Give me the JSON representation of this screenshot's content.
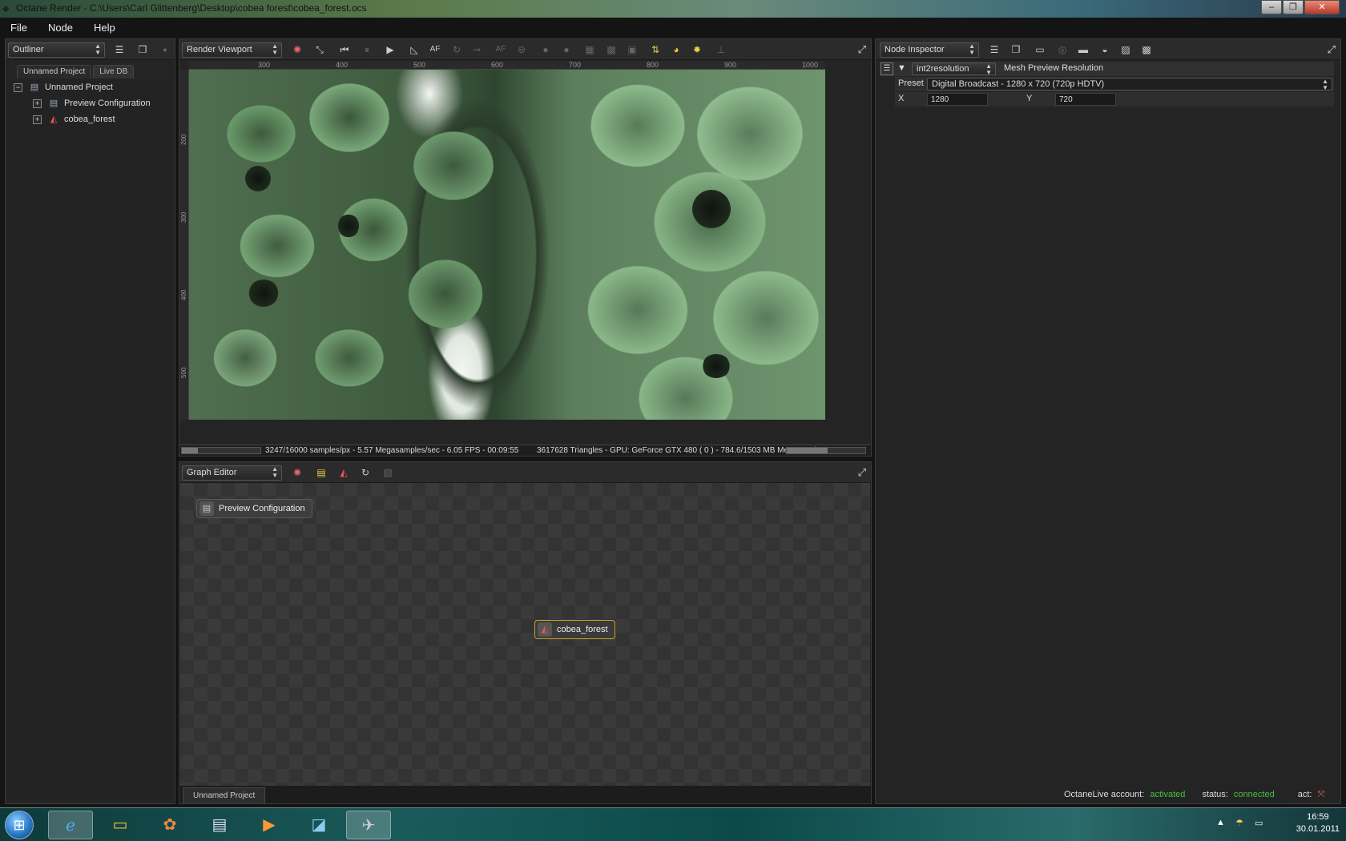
{
  "window": {
    "title": "Octane Render - C:\\Users\\Carl Glittenberg\\Desktop\\cobea forest\\cobea_forest.ocs",
    "minimize": "–",
    "maximize": "❐",
    "close": "✕"
  },
  "menu": {
    "items": [
      "File",
      "Node",
      "Help"
    ]
  },
  "outliner": {
    "dropdown": "Outliner",
    "tabs": [
      "Unnamed Project",
      "Live DB"
    ],
    "tree": [
      {
        "label": "Unnamed Project",
        "expander": "−",
        "icon": "project-icon"
      },
      {
        "label": "Preview Configuration",
        "expander": "+",
        "icon": "config-icon"
      },
      {
        "label": "cobea_forest",
        "expander": "+",
        "icon": "mesh-icon"
      }
    ]
  },
  "viewport": {
    "dropdown": "Render Viewport",
    "ruler_h": [
      "300",
      "400",
      "500",
      "600",
      "700",
      "800",
      "900",
      "1000"
    ],
    "ruler_v": [
      "200",
      "300",
      "400",
      "500"
    ],
    "status_left": "3247/16000 samples/px - 5.57 Megasamples/sec - 6.05 FPS - 00:09:55",
    "status_right": "3617628 Triangles - GPU: GeForce GTX 480 ( 0 ) - 784.6/1503 MB Mem Used",
    "sample_progress": 0.203,
    "mem_progress": 0.522,
    "af_label": "AF",
    "af2_label": "AF"
  },
  "graph": {
    "dropdown": "Graph Editor",
    "nodes": [
      {
        "label": "Preview Configuration"
      },
      {
        "label": "cobea_forest"
      }
    ],
    "tab": "Unnamed Project"
  },
  "inspector": {
    "dropdown": "Node Inspector",
    "node_type": "int2resolution",
    "node_name": "Mesh Preview Resolution",
    "preset_label": "Preset",
    "preset_value": "Digital Broadcast - 1280 x 720  (720p HDTV)",
    "x_label": "X",
    "x_value": "1280",
    "y_label": "Y",
    "y_value": "720",
    "account_label": "OctaneLive account:",
    "account_value": "activated",
    "status_label": "status:",
    "status_value": "connected",
    "act_label": "act:"
  },
  "taskbar": {
    "time": "16:59",
    "date": "30.01.2011",
    "apps": [
      "internet-explorer-icon",
      "explorer-folder-icon",
      "paint-palette-icon",
      "notepad-icon",
      "media-player-icon",
      "image-viewer-icon",
      "octane-render-icon"
    ]
  },
  "colors": {
    "status_green": "#3ec43e",
    "node_border": "#c9a227"
  }
}
